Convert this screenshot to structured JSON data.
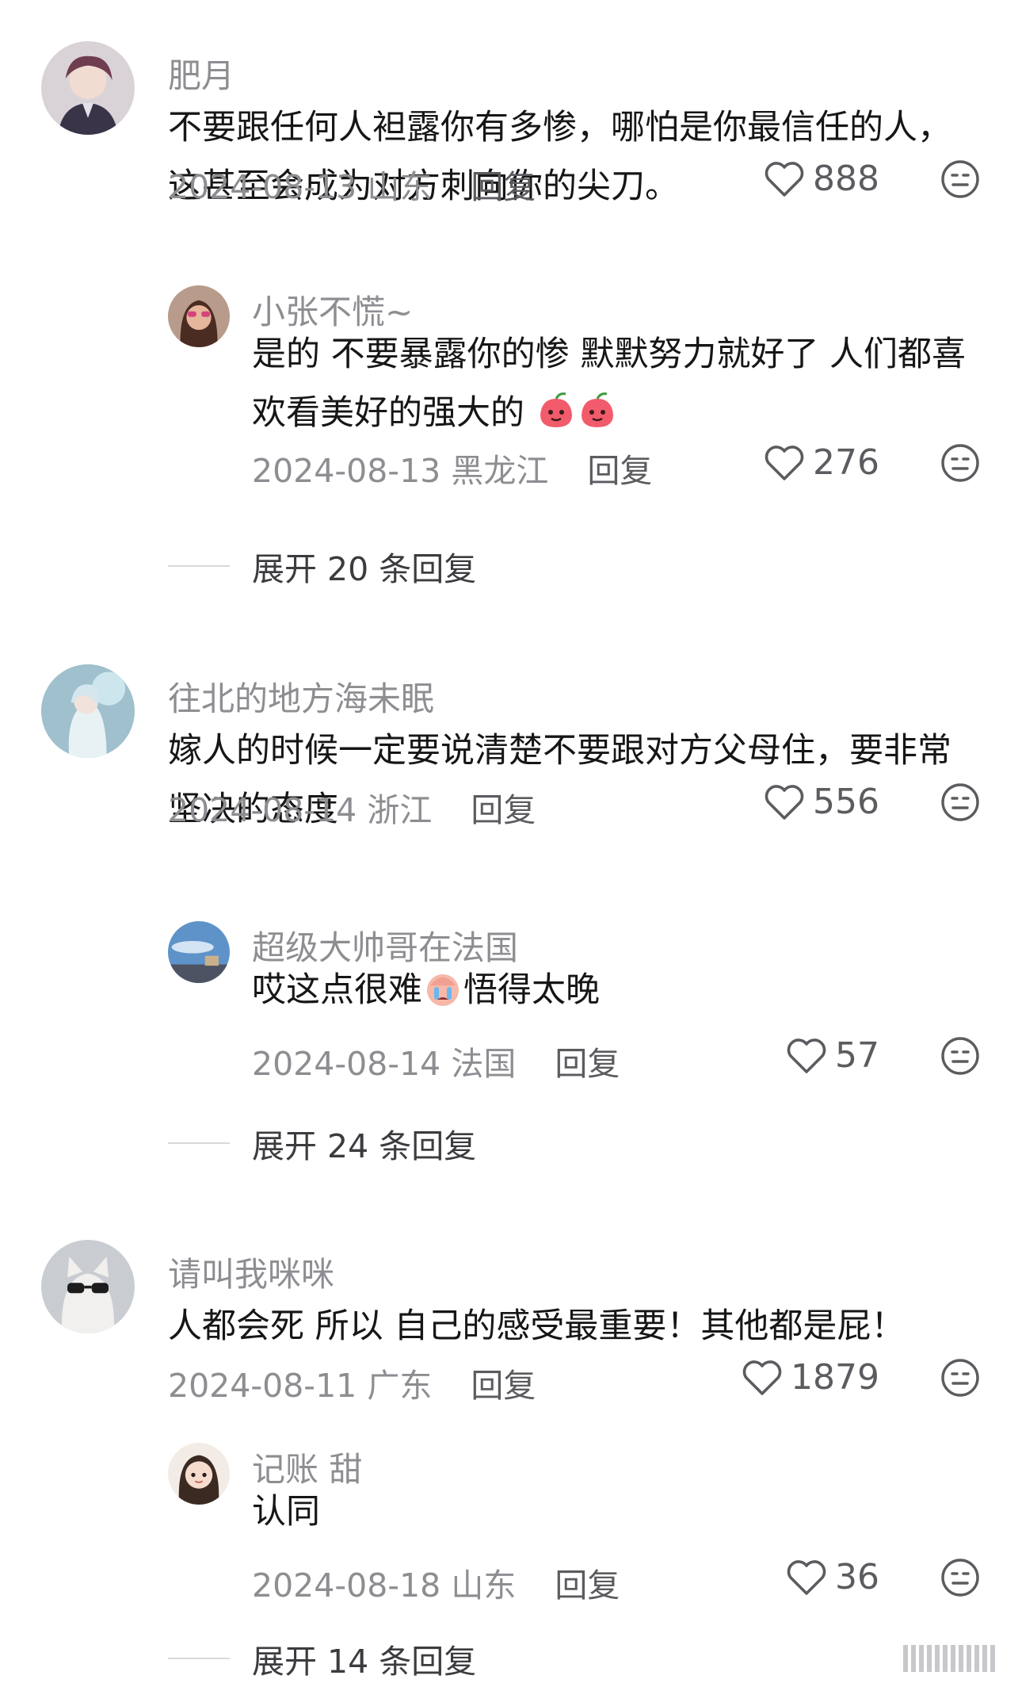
{
  "comments": [
    {
      "username": "肥月",
      "text": "不要跟任何人袒露你有多惨，哪怕是你最信任的人，这甚至会成为对方刺向你的尖刀。",
      "date": "2024-08-13",
      "location": "山东",
      "reply_label": "回复",
      "likes": "888",
      "avatar_icon": "avatar-anime-man-icon",
      "reply": {
        "username": "小张不慌~",
        "text": "是的 不要暴露你的惨 默默努力就好了 人们都喜欢看美好的强大的",
        "emoji": "peach-face-emoji",
        "date": "2024-08-13",
        "location": "黑龙江",
        "reply_label": "回复",
        "likes": "276",
        "avatar_icon": "avatar-woman-icon"
      },
      "expand_label": "展开 20 条回复"
    },
    {
      "username": "往北的地方海未眠",
      "text": "嫁人的时候一定要说清楚不要跟对方父母住，要非常坚决的态度",
      "date": "2024-08-14",
      "location": "浙江",
      "reply_label": "回复",
      "likes": "556",
      "avatar_icon": "avatar-fantasy-woman-icon",
      "reply": {
        "username": "超级大帅哥在法国",
        "text_before": "哎这点很难",
        "text_after": "悟得太晚",
        "emoji": "crying-face-emoji",
        "date": "2024-08-14",
        "location": "法国",
        "reply_label": "回复",
        "likes": "57",
        "avatar_icon": "avatar-sky-landscape-icon"
      },
      "expand_label": "展开 24 条回复"
    },
    {
      "username": "请叫我咪咪",
      "text": "人都会死 所以 自己的感受最重要！其他都是屁！",
      "date": "2024-08-11",
      "location": "广东",
      "reply_label": "回复",
      "likes": "1879",
      "avatar_icon": "avatar-cat-sunglasses-icon",
      "reply": {
        "username": "记账 甜",
        "text": "认同",
        "date": "2024-08-18",
        "location": "山东",
        "reply_label": "回复",
        "likes": "36",
        "avatar_icon": "avatar-cartoon-girl-icon"
      },
      "expand_label": "展开 14 条回复"
    }
  ],
  "icons": {
    "like": "heart-outline-icon",
    "dislike": "dislike-face-icon"
  },
  "colors": {
    "text": "#161616",
    "muted": "#8d8d92",
    "action": "#5b5b60"
  }
}
